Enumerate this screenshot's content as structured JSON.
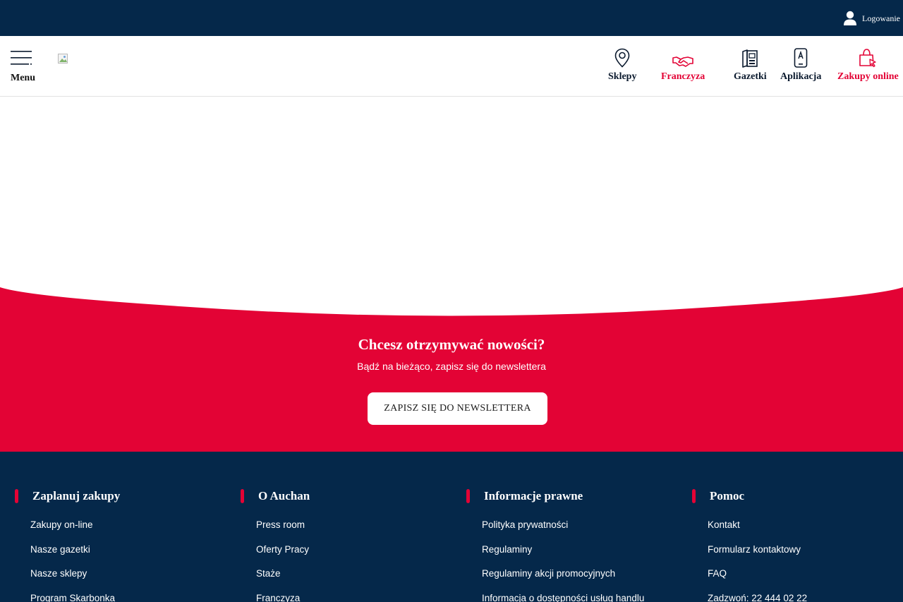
{
  "topbar": {
    "login_label": "Logowanie"
  },
  "header": {
    "menu_label": "Menu",
    "nav": [
      {
        "label": "Sklepy",
        "icon": "location-pin-icon"
      },
      {
        "label": "Franczyza",
        "icon": "handshake-icon"
      },
      {
        "label": "Gazetki",
        "icon": "leaflet-icon"
      },
      {
        "label": "Aplikacja",
        "icon": "smartphone-icon"
      },
      {
        "label": "Zakupy online",
        "icon": "shopping-bag-icon"
      }
    ]
  },
  "newsletter": {
    "title": "Chcesz otrzymywać nowości?",
    "subtitle": "Bądź na bieżąco, zapisz się do newslettera",
    "button_label": "ZAPISZ SIĘ DO NEWSLETTERA"
  },
  "footer": {
    "columns": [
      {
        "title": "Zaplanuj zakupy",
        "links": [
          "Zakupy on-line",
          "Nasze gazetki",
          "Nasze sklepy",
          "Program Skarbonka"
        ]
      },
      {
        "title": "O Auchan",
        "links": [
          "Press room",
          "Oferty Pracy",
          "Staże",
          "Franczyza"
        ]
      },
      {
        "title": "Informacje prawne",
        "links": [
          "Polityka prywatności",
          "Regulaminy",
          "Regulaminy akcji promocyjnych",
          "Informacja o dostępności usług handlu"
        ]
      },
      {
        "title": "Pomoc",
        "links": [
          "Kontakt",
          "Formularz kontaktowy",
          "FAQ",
          "Zadzwoń: 22 444 02 22"
        ]
      }
    ]
  },
  "colors": {
    "navy": "#05284a",
    "red": "#e30335",
    "white": "#ffffff"
  }
}
